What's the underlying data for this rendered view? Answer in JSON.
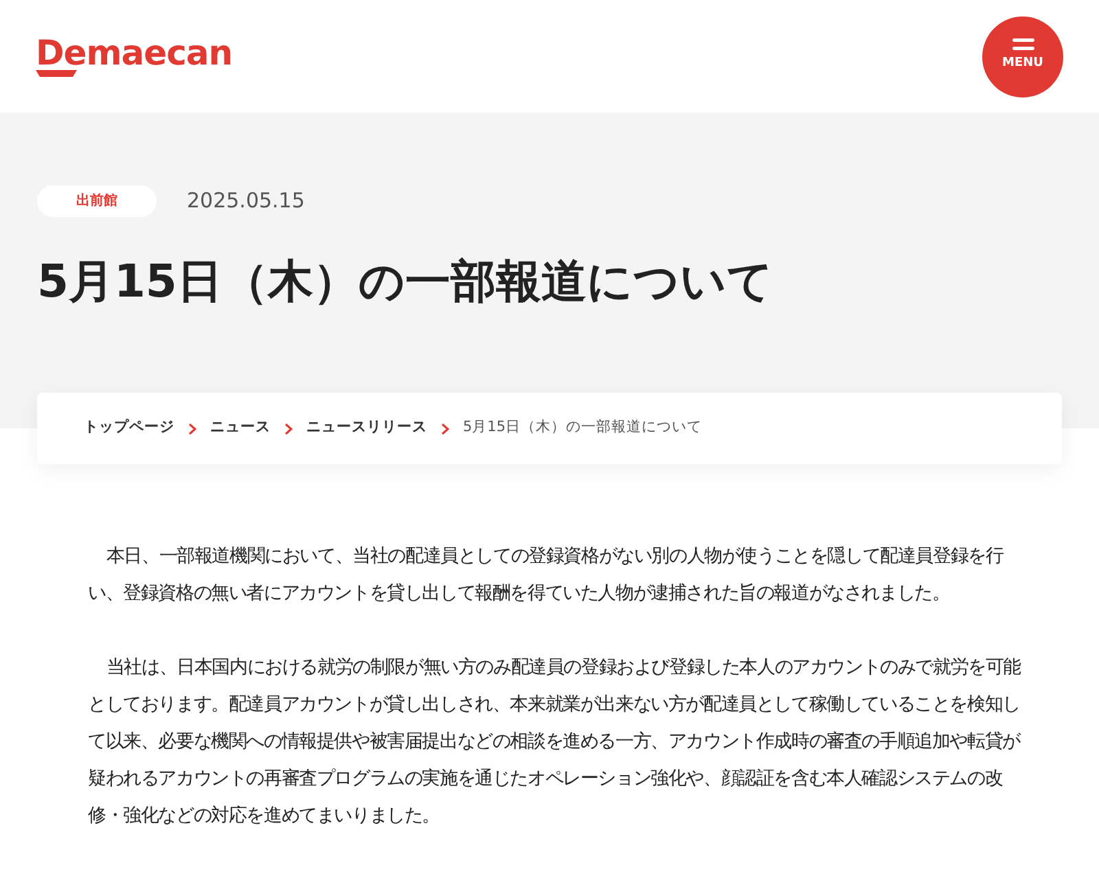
{
  "header": {
    "logo": "Demaecan",
    "menu_button": "MENU"
  },
  "article": {
    "category": "出前館",
    "date": "2025.05.15",
    "title": "5月15日（木）の一部報道について"
  },
  "breadcrumb": [
    {
      "label": "トップページ",
      "current": false
    },
    {
      "label": "ニュース",
      "current": false
    },
    {
      "label": "ニュースリリース",
      "current": false
    },
    {
      "label": "5月15日（木）の一部報道について",
      "current": true
    }
  ],
  "body": [
    "本日、一部報道機関において、当社の配達員としての登録資格がない別の人物が使うことを隠して配達員登録を行い、登録資格の無い者にアカウントを貸し出して報酬を得ていた人物が逮捕された旨の報道がなされました。",
    "当社は、日本国内における就労の制限が無い方のみ配達員の登録および登録した本人のアカウントのみで就労を可能としております。配達員アカウントが貸し出しされ、本来就業が出来ない方が配達員として稼働していることを検知して以来、必要な機関への情報提供や被害届提出などの相談を進める一方、アカウント作成時の審査の手順追加や転貸が疑われるアカウントの再審査プログラムの実施を通じたオペレーション強化や、顔認証を含む本人確認システムの改修・強化などの対応を進めてまいりました。"
  ]
}
